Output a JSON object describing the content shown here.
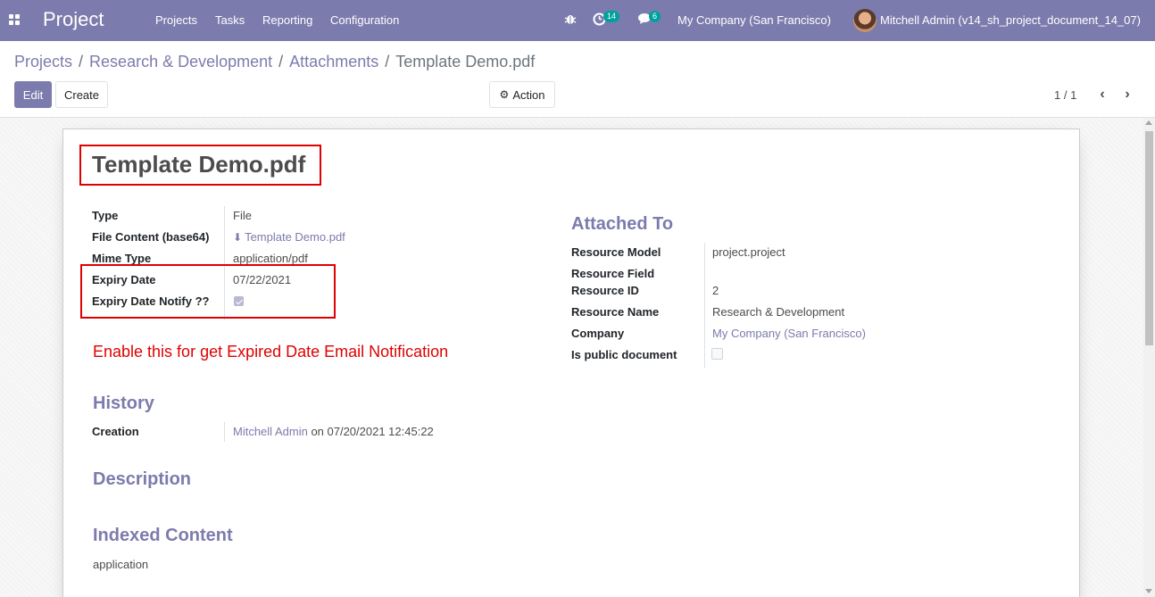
{
  "navbar": {
    "app_title": "Project",
    "menu": [
      "Projects",
      "Tasks",
      "Reporting",
      "Configuration"
    ],
    "activity_count": "14",
    "message_count": "6",
    "company": "My Company (San Francisco)",
    "user": "Mitchell Admin (v14_sh_project_document_14_07)"
  },
  "breadcrumb": {
    "items": [
      "Projects",
      "Research & Development",
      "Attachments"
    ],
    "current": "Template Demo.pdf",
    "separator": "/"
  },
  "toolbar": {
    "edit_label": "Edit",
    "create_label": "Create",
    "action_label": "Action",
    "pager": "1 / 1"
  },
  "record": {
    "title": "Template Demo.pdf",
    "fields": {
      "type": {
        "label": "Type",
        "value": "File"
      },
      "file_content": {
        "label": "File Content (base64)",
        "value": "Template Demo.pdf"
      },
      "mime_type": {
        "label": "Mime Type",
        "value": "application/pdf"
      },
      "expiry_date": {
        "label": "Expiry Date",
        "value": "07/22/2021"
      },
      "expiry_notify": {
        "label": "Expiry Date Notify ??",
        "checked": true
      }
    },
    "note": "Enable this for get Expired Date Email Notification",
    "attached_to": {
      "heading": "Attached To",
      "resource_model": {
        "label": "Resource Model",
        "value": "project.project"
      },
      "resource_field": {
        "label": "Resource Field",
        "value": ""
      },
      "resource_id": {
        "label": "Resource ID",
        "value": "2"
      },
      "resource_name": {
        "label": "Resource Name",
        "value": "Research & Development"
      },
      "company": {
        "label": "Company",
        "value": "My Company (San Francisco)"
      },
      "is_public": {
        "label": "Is public document",
        "checked": false
      }
    },
    "history": {
      "heading": "History",
      "creation_label": "Creation",
      "creation_user": "Mitchell Admin",
      "creation_on": "on 07/20/2021 12:45:22"
    },
    "description_heading": "Description",
    "indexed_content": {
      "heading": "Indexed Content",
      "value": "application"
    }
  },
  "colors": {
    "brand": "#7c7bad",
    "annotation_red": "#e00000",
    "badge_teal": "#00a09d"
  }
}
